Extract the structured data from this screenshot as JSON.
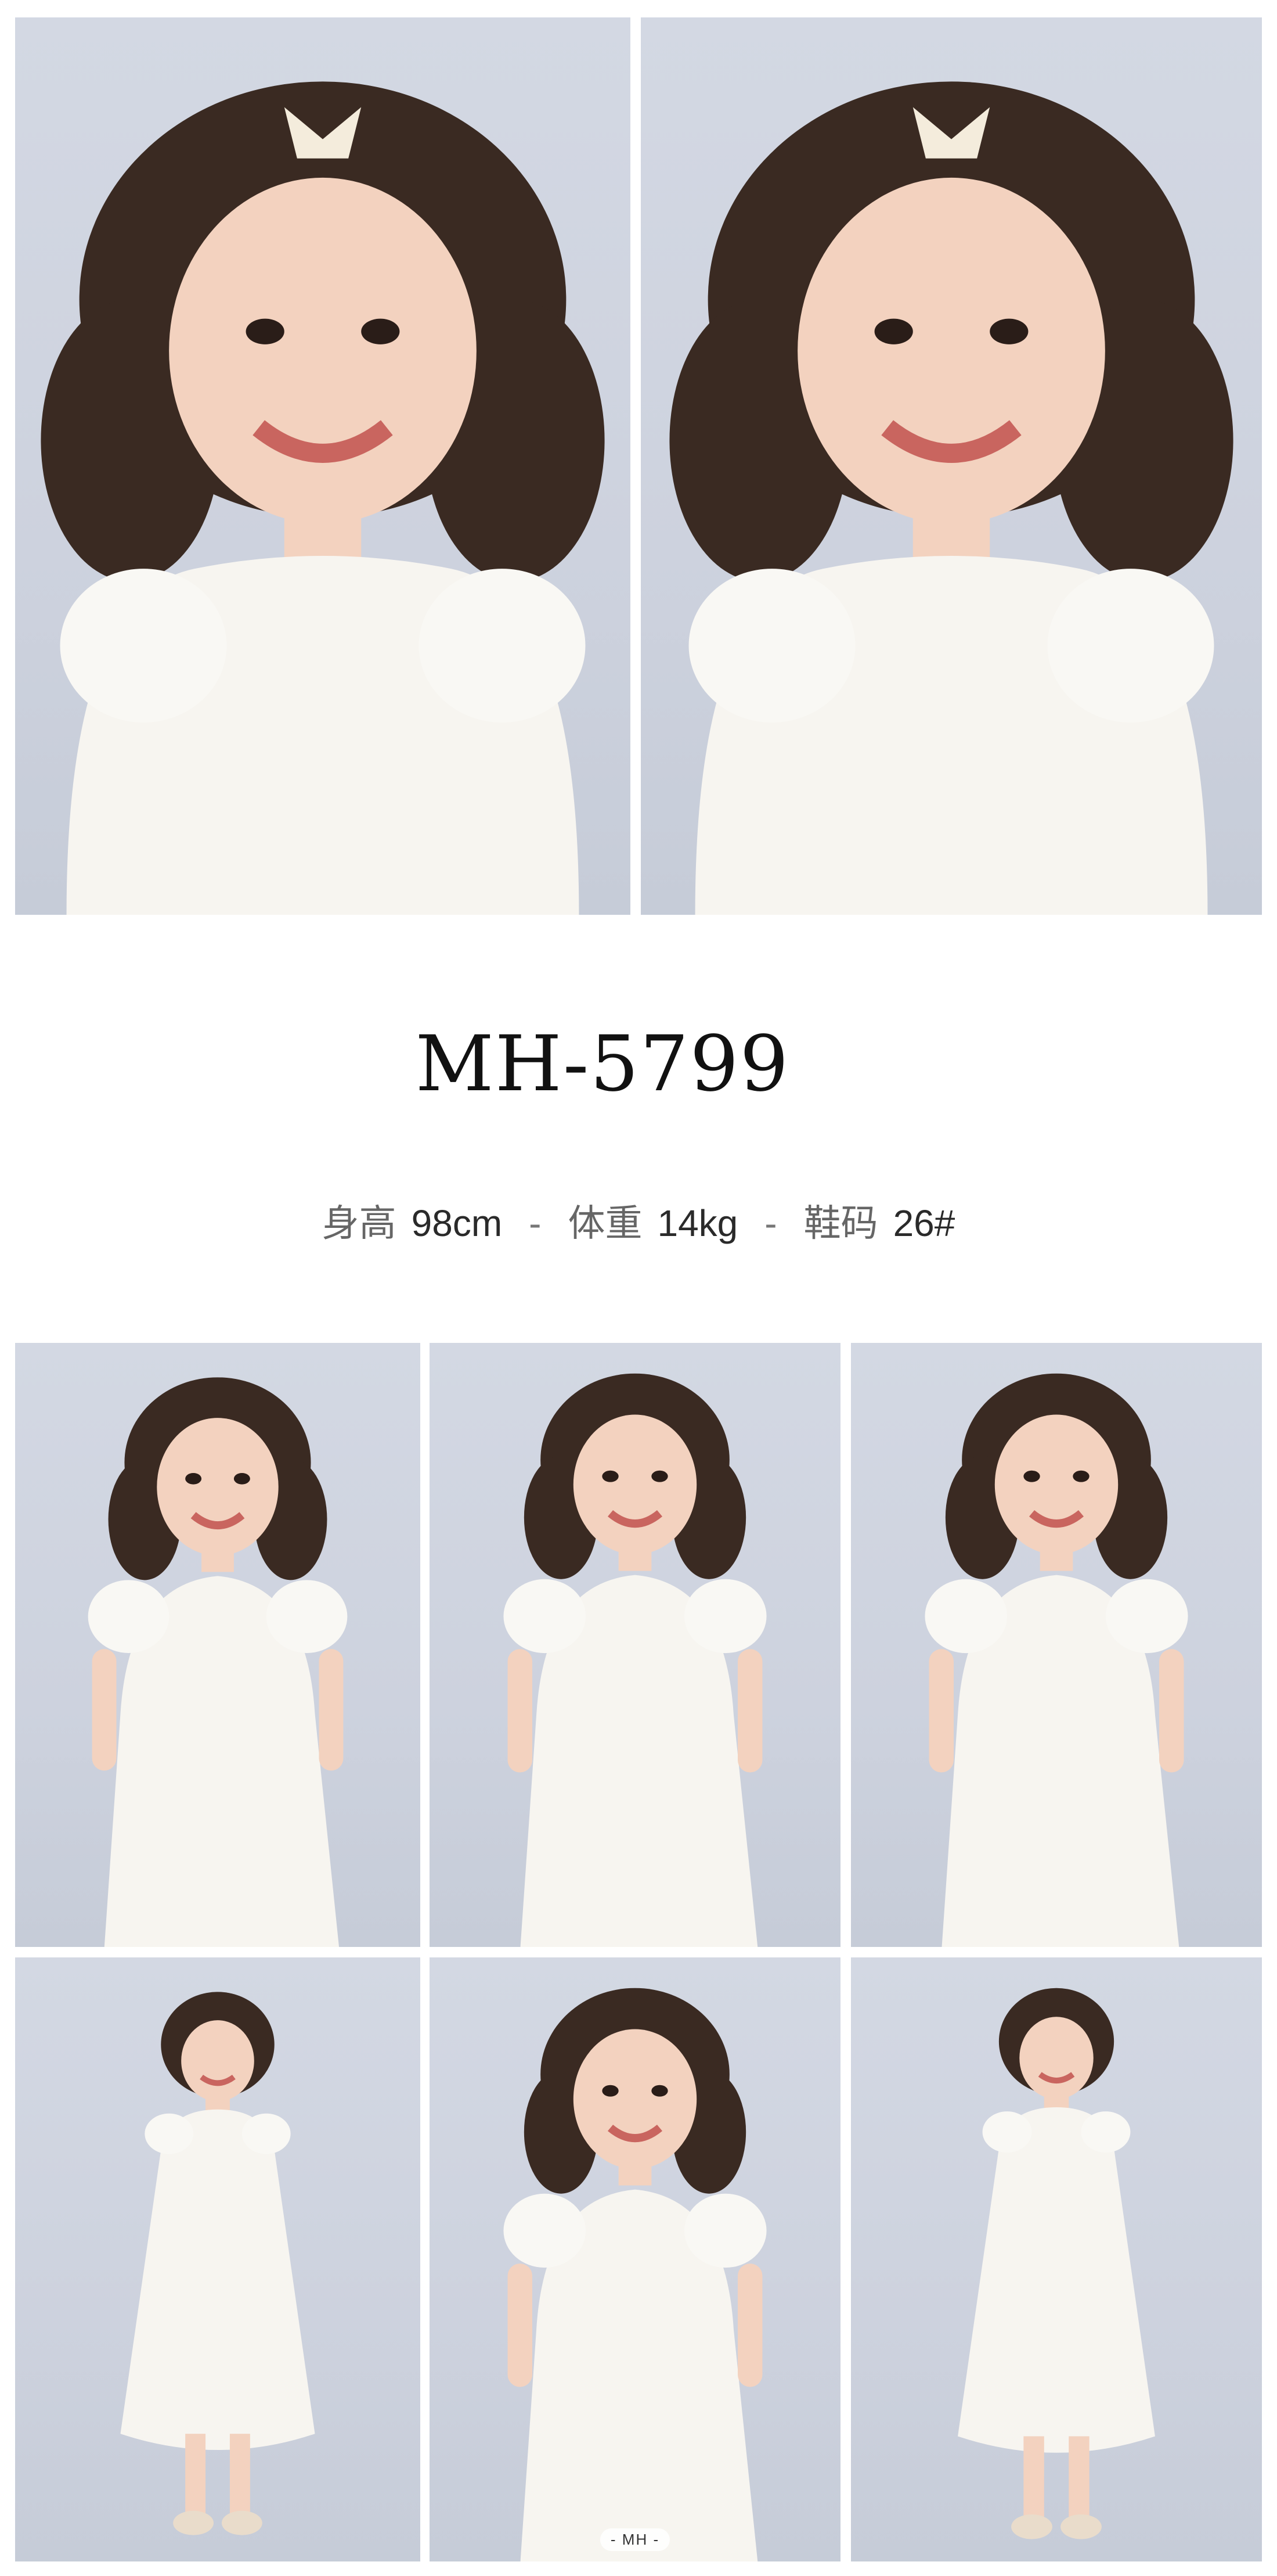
{
  "product": {
    "code": "MH-5799"
  },
  "specs": {
    "height_label": "身高",
    "height_value": "98cm",
    "weight_label": "体重",
    "weight_value": "14kg",
    "shoe_label": "鞋码",
    "shoe_value": "26#",
    "separator": "-"
  },
  "photos": {
    "watermark": "- MH -"
  },
  "colors": {
    "backdrop": "#cdd2de",
    "dress": "#f7f5f0",
    "hair": "#3a2a22",
    "skin": "#f3d2bf"
  }
}
